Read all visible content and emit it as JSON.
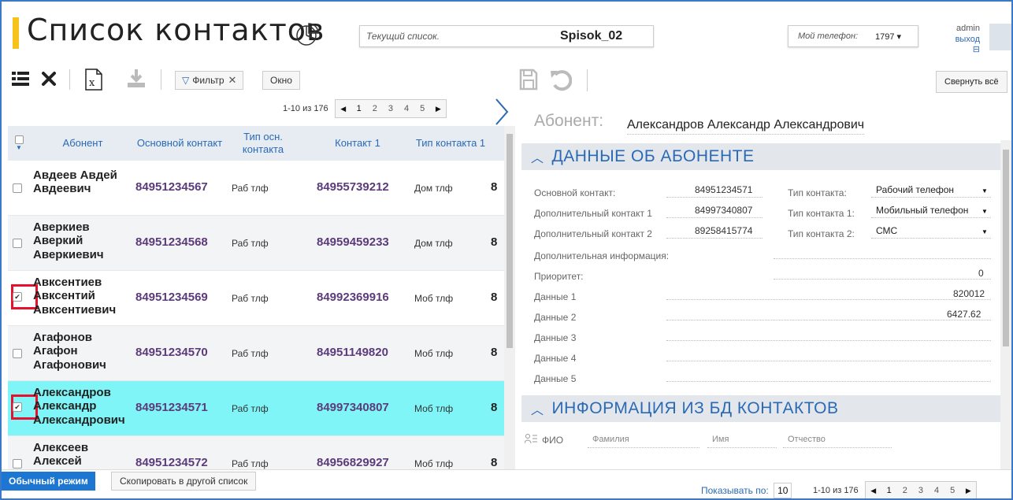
{
  "header": {
    "title": "Список контактов",
    "current_list_label": "Текущий список.",
    "current_list_value": "Spisok_02",
    "my_phone_label": "Мой телефон:",
    "my_phone_value": "1797 ▾",
    "user_name": "admin",
    "logout": "выход ⊟"
  },
  "toolbar": {
    "filter_label": "Фильтр",
    "filter_clear": "✕",
    "window_label": "Окно"
  },
  "pager_top": {
    "info": "1-10 из 176",
    "pages": [
      "1",
      "2",
      "3",
      "4",
      "5"
    ]
  },
  "table": {
    "columns": [
      "Абонент",
      "Основной контакт",
      "Тип осн. контакта",
      "Контакт 1",
      "Тип контакта 1"
    ],
    "rows": [
      {
        "name": "Авдеев Авдей Авдеевич",
        "main": "84951234567",
        "main_type": "Раб тлф",
        "c1": "84955739212",
        "c1_type": "Дом тлф",
        "c2": "8",
        "checked": false
      },
      {
        "name": "Аверкиев Аверкий Аверкиевич",
        "main": "84951234568",
        "main_type": "Раб тлф",
        "c1": "84959459233",
        "c1_type": "Дом тлф",
        "c2": "8",
        "checked": false
      },
      {
        "name": "Авксентиев Авксентий Авксентиевич",
        "main": "84951234569",
        "main_type": "Раб тлф",
        "c1": "84992369916",
        "c1_type": "Моб тлф",
        "c2": "8",
        "checked": true
      },
      {
        "name": "Агафонов Агафон Агафонович",
        "main": "84951234570",
        "main_type": "Раб тлф",
        "c1": "84951149820",
        "c1_type": "Моб тлф",
        "c2": "8",
        "checked": false
      },
      {
        "name": "Александров Александр Александрович",
        "main": "84951234571",
        "main_type": "Раб тлф",
        "c1": "84997340807",
        "c1_type": "Моб тлф",
        "c2": "8",
        "checked": true
      },
      {
        "name": "Алексеев Алексей Алексеевич",
        "main": "84951234572",
        "main_type": "Раб тлф",
        "c1": "84956829927",
        "c1_type": "Моб тлф",
        "c2": "8",
        "checked": false
      }
    ]
  },
  "bottom": {
    "mode_label": "Обычный режим",
    "copy_label": "Скопировать в другой список",
    "show_by_label": "Показывать по:",
    "show_by_value": "10",
    "pager_info": "1-10 из 176",
    "pages": [
      "1",
      "2",
      "3",
      "4",
      "5"
    ]
  },
  "detail": {
    "collapse_all": "Свернуть всё",
    "subscriber_label": "Абонент:",
    "subscriber_name": "Александров Александр Александрович",
    "section1": "ДАННЫЕ ОБ АБОНЕНТЕ",
    "main_contact_label": "Основной контакт:",
    "main_contact_value": "84951234571",
    "extra1_label": "Дополнительный контакт 1",
    "extra1_value": "84997340807",
    "extra2_label": "Дополнительный контакт 2",
    "extra2_value": "89258415774",
    "type_label": "Тип контакта:",
    "type_value": "Рабочий телефон",
    "type1_label": "Тип контакта 1:",
    "type1_value": "Мобильный телефон",
    "type2_label": "Тип контакта 2:",
    "type2_value": "СМС",
    "extra_info_label": "Дополнительная информация:",
    "priority_label": "Приоритет:",
    "priority_value": "0",
    "data1_label": "Данные 1",
    "data1_value": "820012",
    "data2_label": "Данные 2",
    "data2_value": "6427.62",
    "data3_label": "Данные 3",
    "data4_label": "Данные 4",
    "data5_label": "Данные 5",
    "section2": "ИНФОРМАЦИЯ ИЗ БД КОНТАКТОВ",
    "fio_label": "ФИО",
    "fio_last": "Фамилия",
    "fio_first": "Имя",
    "fio_middle": "Отчество"
  },
  "colors": {
    "accent_yellow": "#f6c31a",
    "selected_row": "#7ff5f7",
    "link_blue": "#2a6ab5",
    "phone_purple": "#5c3b7a",
    "mark_red": "#e8112d",
    "mode_blue": "#1c76d2"
  }
}
